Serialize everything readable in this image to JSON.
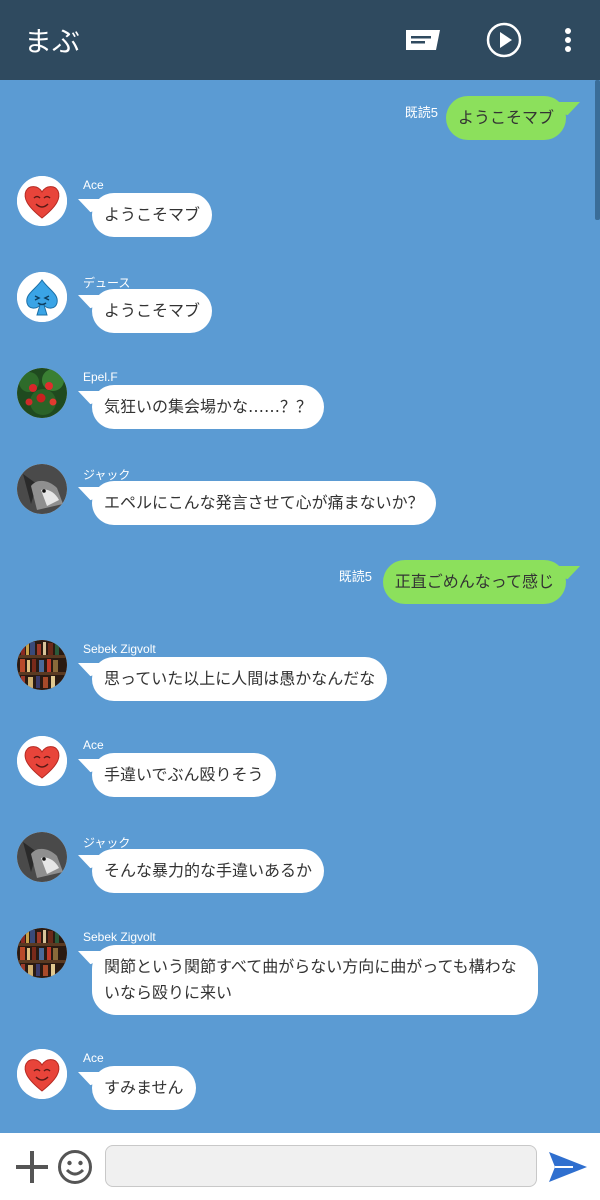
{
  "header": {
    "title": "まぶ",
    "icons": [
      "memo-icon",
      "play-icon",
      "more-vertical-icon"
    ]
  },
  "messages": [
    {
      "type": "out",
      "read": "既読5",
      "text": "ようこそマブ"
    },
    {
      "type": "in",
      "sender": "Ace",
      "avatar": "heart-avatar",
      "text": "ようこそマブ"
    },
    {
      "type": "in",
      "sender": "デュース",
      "avatar": "spade-avatar",
      "text": "ようこそマブ"
    },
    {
      "type": "in",
      "sender": "Epel.F",
      "avatar": "apple-tree-avatar",
      "text": "気狂いの集会場かな……？？"
    },
    {
      "type": "in",
      "sender": "ジャック",
      "avatar": "wolf-avatar",
      "text": "エペルにこんな発言させて心が痛まないか？"
    },
    {
      "type": "out",
      "read": "既読5",
      "text": "正直ごめんなって感じ"
    },
    {
      "type": "in",
      "sender": "Sebek Zigvolt",
      "avatar": "bookshelf-avatar",
      "text": "思っていた以上に人間は愚かなんだな"
    },
    {
      "type": "in",
      "sender": "Ace",
      "avatar": "heart-avatar",
      "text": "手違いでぶん殴りそう"
    },
    {
      "type": "in",
      "sender": "ジャック",
      "avatar": "wolf-avatar",
      "text": "そんな暴力的な手違いあるか"
    },
    {
      "type": "in",
      "sender": "Sebek Zigvolt",
      "avatar": "bookshelf-avatar",
      "text": "関節という関節すべて曲がらない方向に曲がっても構わないなら殴りに来い"
    },
    {
      "type": "in",
      "sender": "Ace",
      "avatar": "heart-avatar",
      "text": "すみません"
    }
  ],
  "composer": {
    "placeholder": "",
    "icons": [
      "plus-icon",
      "emoji-icon",
      "send-icon"
    ]
  },
  "colors": {
    "header_bg": "#2f4a5f",
    "chat_bg": "#5b9bd3",
    "outgoing_bubble": "#8ce05c",
    "incoming_bubble": "#ffffff",
    "send_icon": "#2f6fcf"
  }
}
